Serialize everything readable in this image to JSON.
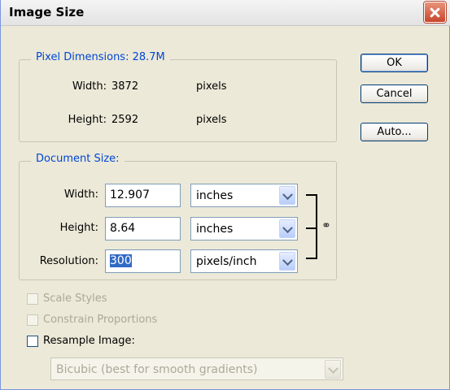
{
  "window": {
    "title": "Image Size"
  },
  "buttons": {
    "ok": "OK",
    "cancel": "Cancel",
    "auto": "Auto..."
  },
  "pixel_dimensions": {
    "legend": "Pixel Dimensions:",
    "size": "28.7M",
    "width_label": "Width:",
    "width_value": "3872",
    "width_unit": "pixels",
    "height_label": "Height:",
    "height_value": "2592",
    "height_unit": "pixels"
  },
  "document_size": {
    "legend": "Document Size:",
    "width_label": "Width:",
    "width_value": "12.907",
    "width_unit": "inches",
    "height_label": "Height:",
    "height_value": "8.64",
    "height_unit": "inches",
    "resolution_label": "Resolution:",
    "resolution_value": "300",
    "resolution_unit": "pixels/inch"
  },
  "options": {
    "scale_styles": {
      "label": "Scale Styles",
      "checked": false,
      "enabled": false
    },
    "constrain_proportions": {
      "label": "Constrain Proportions",
      "checked": false,
      "enabled": false
    },
    "resample_image": {
      "label": "Resample Image:",
      "checked": false,
      "enabled": true
    },
    "resample_method": {
      "value": "Bicubic (best for smooth gradients)",
      "enabled": false
    }
  },
  "icons": {
    "close": "close-icon",
    "dropdown": "chevron-down-icon",
    "link": "chain-link-icon"
  },
  "colors": {
    "legend_text": "#0046d5",
    "dialog_bg": "#ece9d8",
    "selection": "#316ac5",
    "disabled_text": "#aca899"
  }
}
